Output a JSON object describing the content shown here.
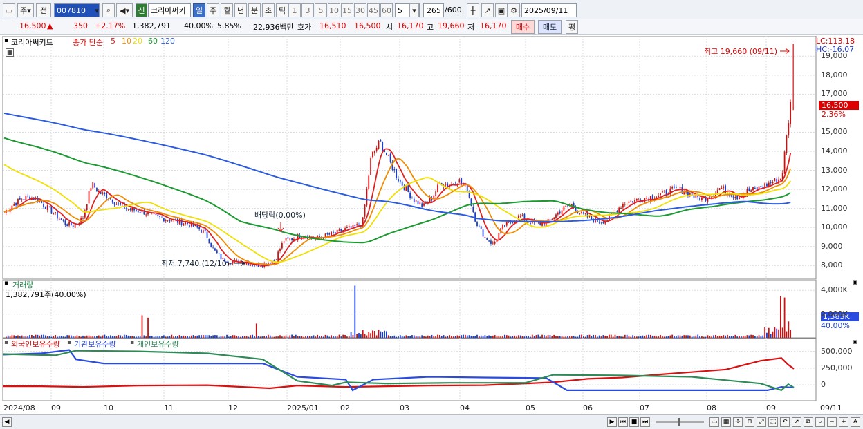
{
  "toolbar": {
    "type_label": "주",
    "prev_label": "전",
    "code_value": "007810",
    "new_badge": "신",
    "stock_name": "코리아써키",
    "periods": [
      "일",
      "주",
      "월",
      "년",
      "분",
      "초",
      "틱"
    ],
    "active_period": "일",
    "intervals": [
      "1",
      "3",
      "5",
      "10",
      "15",
      "30",
      "45",
      "60"
    ],
    "interval_value": "5",
    "count_value": "265",
    "count_total": "/600",
    "date_value": "2025/09/11"
  },
  "quote": {
    "price": "16,500",
    "change": "350",
    "change_pct": "+2.17%",
    "volume": "1,382,791",
    "vol_ratio": "40.00%",
    "turnover": "5.85%",
    "amount": "22,936백만",
    "ask_label": "호가",
    "ask1": "16,510",
    "ask2": "16,500",
    "open_label": "시",
    "open": "16,170",
    "high_label": "고",
    "high": "19,660",
    "low_label": "저",
    "low": "16,170",
    "buy_button": "매수",
    "sell_button": "매도",
    "eval_button": "평"
  },
  "price_panel": {
    "title": "코리아써키트",
    "ma_label": "종가 단순",
    "ma_periods": [
      "5",
      "10",
      "20",
      "60",
      "120"
    ],
    "ma_colors": [
      "#e02020",
      "#f08a00",
      "#f0e000",
      "#1a9a30",
      "#2a5be0"
    ],
    "lc_label": "LC:113.18",
    "hc_label": "HC:-16.07",
    "max_annotation": "최고 19,660 (09/11)",
    "min_annotation": "최저 7,740 (12/10)",
    "dividend_annotation": "배당락(0.00%)",
    "current_tag": "16,500",
    "current_pct": "2.36%",
    "y_ticks": [
      "19,000",
      "18,000",
      "17,000",
      "15,000",
      "14,000",
      "13,000",
      "12,000",
      "11,000",
      "10,000",
      "9,000",
      "8,000"
    ]
  },
  "volume_panel": {
    "title": "거래량",
    "readout": "1,382,791주(40.00%)",
    "y_ticks": [
      "4,000K",
      "2,000K"
    ],
    "current_tag": "1,383K",
    "current_pct": "40.00%"
  },
  "holding_panel": {
    "legend": [
      "외국인보유수량",
      "기관보유수량",
      "개인보유수량"
    ],
    "colors": [
      "#d81010",
      "#2a4be0",
      "#2e8b57"
    ],
    "y_ticks": [
      "500,000",
      "250,000",
      "0"
    ]
  },
  "x_axis": [
    "2024/08",
    "09",
    "10",
    "11",
    "12",
    "2025/01",
    "02",
    "03",
    "04",
    "05",
    "06",
    "07",
    "08",
    "09",
    "09/11"
  ],
  "chart_data": {
    "type": "candlestick",
    "period": "daily",
    "x_range": [
      "2024/08",
      "2025/09/11"
    ],
    "price_ylim": [
      7500,
      19700
    ],
    "price_close_series": [
      10800,
      11200,
      11500,
      11600,
      11400,
      11000,
      10600,
      10200,
      10100,
      10500,
      12300,
      11800,
      11600,
      11200,
      11000,
      10900,
      10800,
      10600,
      10500,
      10400,
      10300,
      10200,
      10000,
      9700,
      8800,
      8300,
      8200,
      8200,
      8100,
      8000,
      8100,
      8300,
      9300,
      9400,
      9600,
      9500,
      9400,
      9600,
      9700,
      9900,
      10000,
      10200,
      13700,
      14500,
      13600,
      12600,
      12000,
      11400,
      11100,
      11600,
      12400,
      12200,
      12500,
      12000,
      10300,
      9500,
      9100,
      10000,
      10300,
      10600,
      10300,
      10200,
      10200,
      10600,
      11000,
      11200,
      10700,
      10500,
      10300,
      10400,
      10900,
      11300,
      11400,
      11500,
      11600,
      11700,
      11900,
      12000,
      11900,
      11600,
      11500,
      11700,
      12100,
      11800,
      11600,
      11900,
      12000,
      12200,
      12400,
      12600,
      16500
    ],
    "volume_highlights_k": [
      1900,
      1700,
      1200,
      4400,
      3500,
      3400,
      1383
    ]
  }
}
